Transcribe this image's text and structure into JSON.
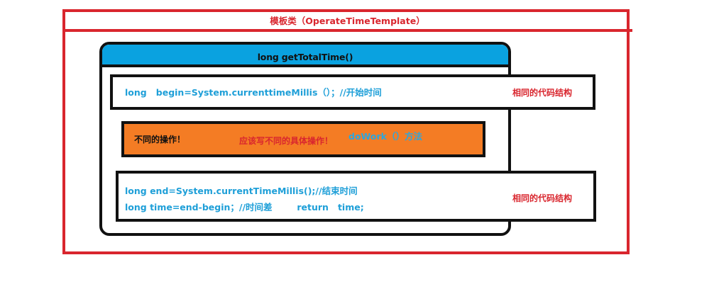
{
  "template_class": {
    "title": "模板类（OperateTimeTemplate）"
  },
  "method": {
    "signature": "long getTotalTime()"
  },
  "common_code_top": {
    "line": "long   begin=System.currenttimeMillis（）；//开始时间",
    "label": "相同的代码结构"
  },
  "different_operation": {
    "left_text": "不同的操作！",
    "middle_text": "应该写不同的具体操作！",
    "right_text": "doWork（）方法"
  },
  "common_code_bottom": {
    "line1": "long end=System.currentTimeMillis();//结束时间",
    "line2": "long time=end-begin；//时间差        return   time;",
    "label": "相同的代码结构"
  },
  "colors": {
    "frame_red": "#d9262e",
    "header_blue": "#0aa2e0",
    "code_blue": "#1e9fd8",
    "orange": "#f47c24",
    "outline_black": "#111111"
  }
}
